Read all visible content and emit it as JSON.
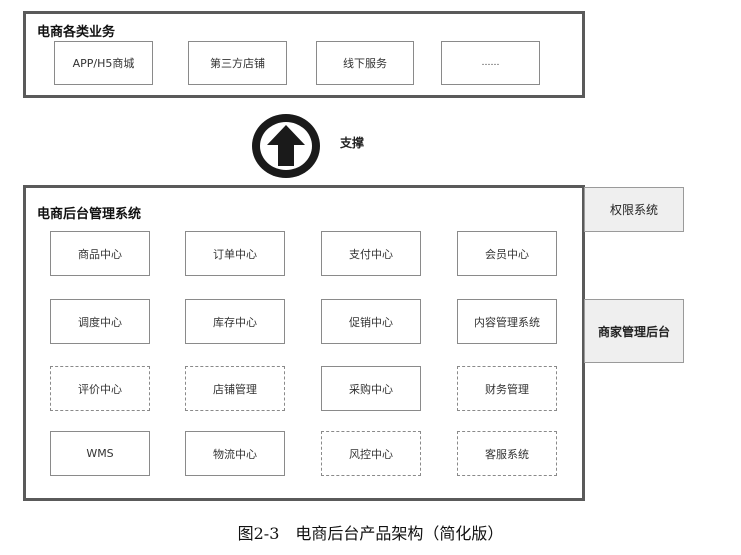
{
  "top_section": {
    "title": "电商各类业务",
    "items": [
      "APP/H5商城",
      "第三方店铺",
      "线下服务",
      "……"
    ]
  },
  "support": {
    "label": "支撑",
    "icon": "up-arrow-circle-icon"
  },
  "main_section": {
    "title": "电商后台管理系统",
    "rows": [
      [
        {
          "label": "商品中心",
          "style": "solid"
        },
        {
          "label": "订单中心",
          "style": "solid"
        },
        {
          "label": "支付中心",
          "style": "solid"
        },
        {
          "label": "会员中心",
          "style": "solid"
        }
      ],
      [
        {
          "label": "调度中心",
          "style": "solid"
        },
        {
          "label": "库存中心",
          "style": "solid"
        },
        {
          "label": "促销中心",
          "style": "solid"
        },
        {
          "label": "内容管理系统",
          "style": "solid"
        }
      ],
      [
        {
          "label": "评价中心",
          "style": "dashed"
        },
        {
          "label": "店铺管理",
          "style": "dashed"
        },
        {
          "label": "采购中心",
          "style": "solid"
        },
        {
          "label": "财务管理",
          "style": "dashed"
        }
      ],
      [
        {
          "label": "WMS",
          "style": "solid"
        },
        {
          "label": "物流中心",
          "style": "solid"
        },
        {
          "label": "风控中心",
          "style": "dashed"
        },
        {
          "label": "客服系统",
          "style": "dashed"
        }
      ]
    ]
  },
  "side_boxes": {
    "permission": "权限系统",
    "merchant": "商家管理后台"
  },
  "caption": "图2-3　电商后台产品架构（简化版）"
}
